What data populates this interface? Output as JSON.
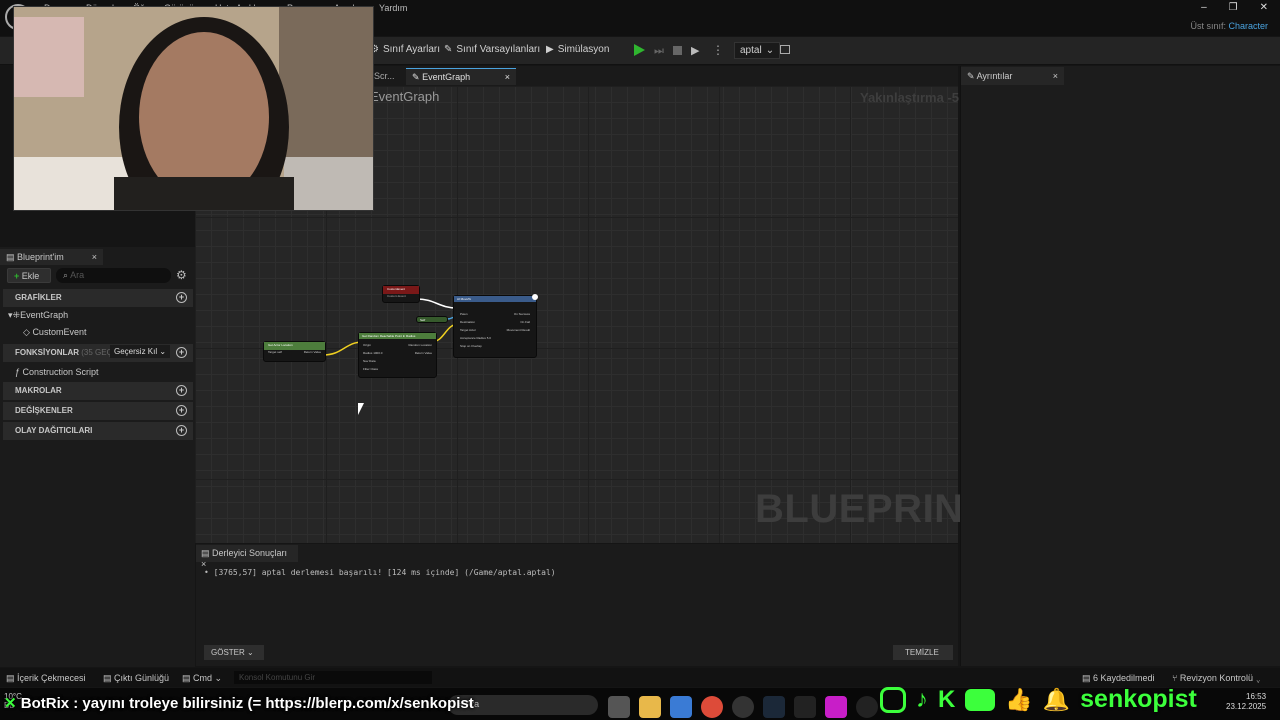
{
  "menu": [
    "Dosya",
    "Düzenle",
    "Öğe",
    "Görünüm",
    "Hata Ayıklama",
    "Pencere",
    "Araçlar",
    "Yardım"
  ],
  "parent_class": {
    "label": "Üst sınıf:",
    "value": "Character"
  },
  "window_controls": [
    "–",
    "❐",
    "✕"
  ],
  "toolbar": {
    "class_settings": "Sınıf Ayarları",
    "class_defaults": "Sınıf Varsayılanları",
    "simulation": "Simülasyon",
    "debug_target": "aptal"
  },
  "tabs": {
    "construction": "Scr...",
    "eventgraph": "EventGraph"
  },
  "graph": {
    "title": "EventGraph",
    "zoom": "Yakınlaştırma -5",
    "watermark": "BLUEPRINT"
  },
  "details": {
    "tab": "Ayrıntılar"
  },
  "my_blueprint": {
    "tab": "Blueprint'im",
    "add": "Ekle",
    "search_placeholder": "Ara",
    "graphs": "GRAFİKLER",
    "eventgraph": "EventGraph",
    "customevent": "CustomEvent",
    "functions": "FONKSİYONLAR",
    "functions_count": "(35 GEÇERS",
    "override": "Geçersiz Kıl",
    "construction_script": "Construction Script",
    "macros": "MAKROLAR",
    "variables": "DEĞİŞKENLER",
    "dispatchers": "OLAY DAĞITICILARI"
  },
  "nodes": {
    "custom_event": {
      "title": "CustomEvent",
      "sub": "Custom Event"
    },
    "get_actor": {
      "title": "Get Actor Location",
      "sub": "Target is Actor",
      "pin_target": "Target",
      "target_val": "self",
      "pin_return": "Return Value"
    },
    "random_point": {
      "title": "Get Random Reachable Point In Radius",
      "pins_left": [
        "Origin",
        "Radius",
        "Nav Data",
        "Filter Class"
      ],
      "pins_right": [
        "Random Location",
        "Return Value"
      ],
      "radius_val": "1000.0"
    },
    "ai_move": {
      "title": "AI MoveTo",
      "pins_left": [
        "Pawn",
        "Destination",
        "Target Actor",
        "Acceptance Radius",
        "Stop on Overlap"
      ],
      "pins_right": [
        "On Success",
        "On Fail",
        "Movement Result"
      ],
      "acc_val": "5.0"
    },
    "self_node": "Self"
  },
  "compiler": {
    "tab": "Derleyici Sonuçları",
    "message": "[3765,57] aptal derlemesi başarılı! [124 ms içinde] (/Game/aptal.aptal)",
    "show": "GÖSTER",
    "clear": "TEMİZLE"
  },
  "statusbar": {
    "content_drawer": "İçerik Çekmecesi",
    "output_log": "Çıktı Günlüğü",
    "cmd": "Cmd",
    "console_placeholder": "Konsol Komutunu Gir",
    "saved": "6 Kaydedilmedi",
    "revision": "Revizyon Kontrolü"
  },
  "taskbar": {
    "weather_temp": "10°C",
    "weather_desc": "Bu",
    "search": "Ara",
    "time": "16:53",
    "date": "23.12.2025",
    "botrix_text": "BotRix : yayını troleye bilirsiniz (= https://blerp.com/x/senkopist",
    "channel": "senkopist"
  },
  "colors": {
    "accent": "#4aa3df",
    "stream_green": "#3cff3c",
    "play_green": "#2fb52f"
  }
}
